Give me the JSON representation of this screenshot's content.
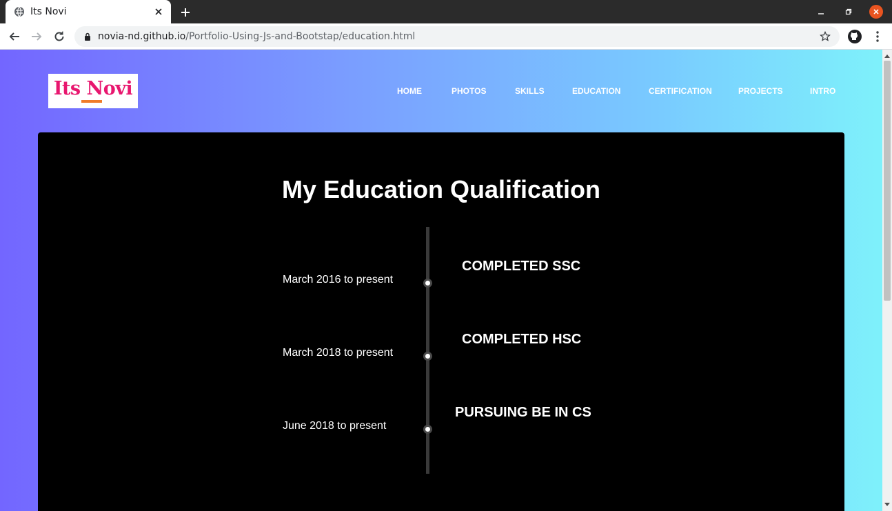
{
  "browser": {
    "tab_title": "Its Novi",
    "url_domain": "novia-nd.github.io",
    "url_path": "/Portfolio-Using-Js-and-Bootstap/education.html"
  },
  "site": {
    "logo_text": "Its Novi",
    "nav": [
      "HOME",
      "PHOTOS",
      "SKILLS",
      "EDUCATION",
      "CERTIFICATION",
      "PROJECTS",
      "INTRO"
    ]
  },
  "education": {
    "heading": "My Education Qualification",
    "items": [
      {
        "date": "March 2016 to present",
        "title": "COMPLETED SSC"
      },
      {
        "date": "March 2018 to present",
        "title": "COMPLETED HSC"
      },
      {
        "date": "June 2018 to present",
        "title": "PURSUING BE IN CS"
      }
    ]
  },
  "colors": {
    "gradient_start": "#7366ff",
    "gradient_end": "#7ef1fb",
    "logo_text": "#e8176f",
    "logo_accent": "#f07c2a",
    "window_close": "#e95420"
  }
}
